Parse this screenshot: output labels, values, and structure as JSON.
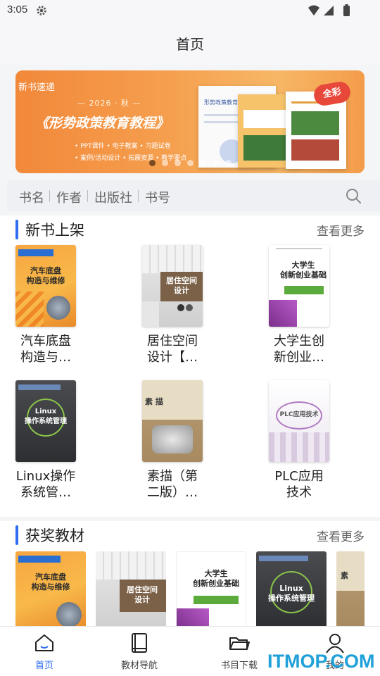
{
  "status_bar": {
    "time": "3:05"
  },
  "header": {
    "title": "首页"
  },
  "banner": {
    "tag": "新书速递",
    "year": "— 2026 · 秋 —",
    "headline": "《形势政策教育教程》",
    "features_1": "• PPT课件  • 电子教案  • 习题试卷",
    "features_2": "• 案例/活动设计  • 拓展资源  • 教学要点",
    "badge": "全彩",
    "book_1_title": "形势政策教育教程",
    "slide_count": 7,
    "active_slide": 0
  },
  "search": {
    "fields": [
      "书名",
      "作者",
      "出版社",
      "书号"
    ]
  },
  "sections": {
    "new_books": {
      "title": "新书上架",
      "more": "查看更多",
      "books": [
        {
          "name": "汽车底盘\n构造与…",
          "cover_text": "汽车底盘\n构造与维修"
        },
        {
          "name": "居住空间\n设计【…",
          "cover_text": "居住空间\n设计"
        },
        {
          "name": "大学生创\n新创业…",
          "cover_text": "大学生\n创新创业基础"
        },
        {
          "name": "Linux操作\n系统管…",
          "cover_text": "Linux\n操作系统管理"
        },
        {
          "name": "素描（第\n二版）…",
          "cover_text": "素 描"
        },
        {
          "name": "PLC应用\n技术",
          "cover_text": "PLC应用技术"
        }
      ]
    },
    "award_books": {
      "title": "获奖教材",
      "more": "查看更多",
      "covers": [
        "汽车底盘\n构造与维修",
        "居住空间\n设计",
        "大学生\n创新创业基础",
        "Linux\n操作系统管理",
        "素"
      ]
    }
  },
  "tabbar": {
    "items": [
      {
        "label": "首页",
        "icon": "home-icon",
        "active": true
      },
      {
        "label": "教材导航",
        "icon": "book-icon",
        "active": false
      },
      {
        "label": "书目下载",
        "icon": "folder-icon",
        "active": false
      },
      {
        "label": "我的",
        "icon": "user-icon",
        "active": false
      }
    ],
    "active_color": "#2f6ef0"
  },
  "watermark": "ITMOP.COM"
}
